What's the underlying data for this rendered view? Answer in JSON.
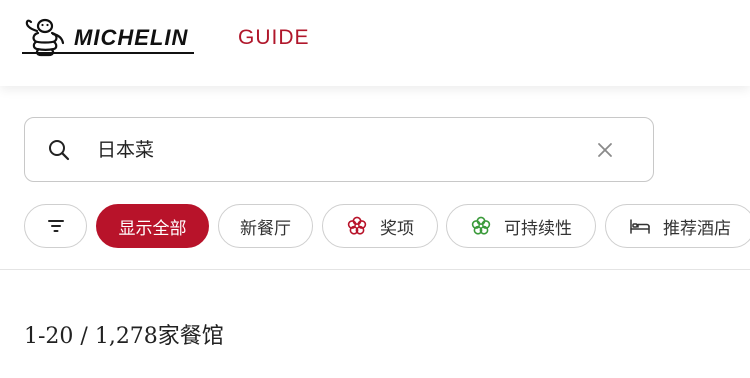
{
  "header": {
    "brand": "MICHELIN",
    "guide": "GUIDE",
    "brand_color": "#b0172b"
  },
  "search": {
    "value": "日本菜",
    "icon": "search-icon",
    "clear_icon": "close-icon"
  },
  "filters": {
    "filter_icon": "filter-icon",
    "chips": [
      {
        "label": "显示全部",
        "active": true
      },
      {
        "label": "新餐厅",
        "active": false
      },
      {
        "label": "奖项",
        "icon": "michelin-flower-icon",
        "active": false
      },
      {
        "label": "可持续性",
        "icon": "green-clover-icon",
        "active": false
      },
      {
        "label": "推荐酒店",
        "icon": "bed-icon",
        "active": false
      }
    ]
  },
  "results": {
    "summary": "1-20 / 1,278家餐馆"
  },
  "colors": {
    "accent": "#b8132a",
    "sustainability": "#3a9a3a"
  }
}
